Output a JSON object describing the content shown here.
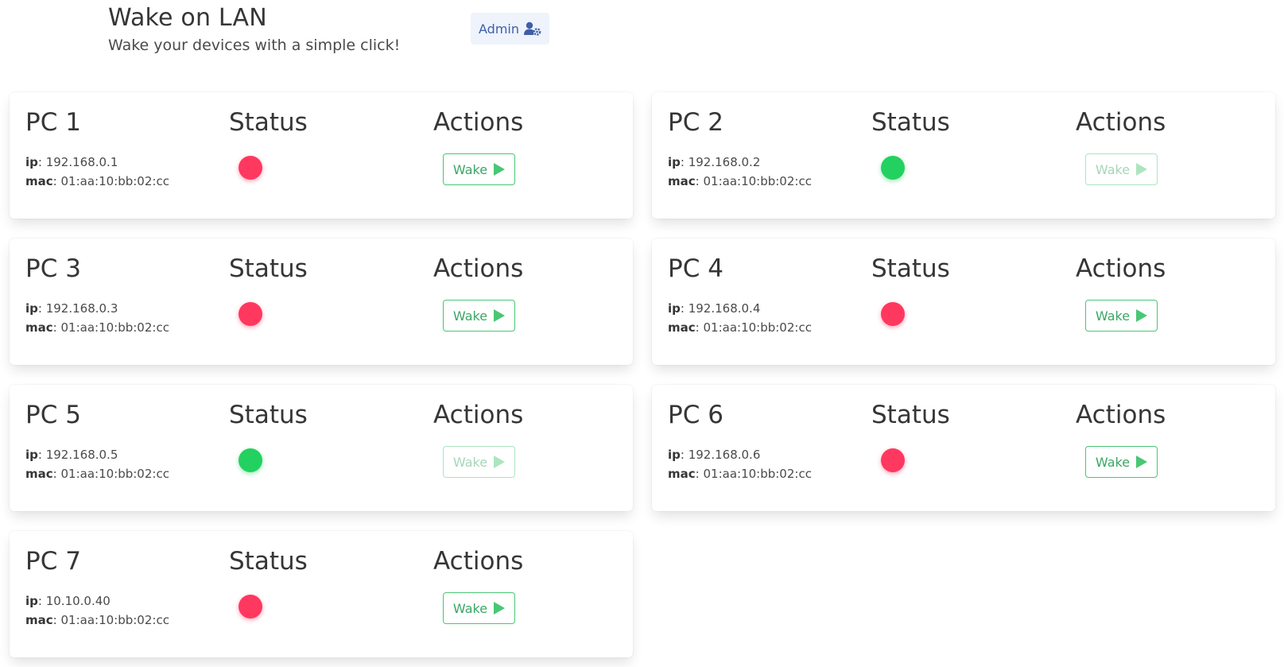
{
  "app": {
    "title": "Wake on LAN",
    "subtitle": "Wake your devices with a simple click!",
    "admin_label": "Admin"
  },
  "labels": {
    "status": "Status",
    "actions": "Actions",
    "ip_key": "ip",
    "mac_key": "mac",
    "wake": "Wake"
  },
  "colors": {
    "online": "#23d160",
    "offline": "#ff3860",
    "wake_accent": "#48c774",
    "admin_accent": "#3e5fa8"
  },
  "devices": [
    {
      "name": "PC 1",
      "ip": "192.168.0.1",
      "mac": "01:aa:10:bb:02:cc",
      "status": "offline"
    },
    {
      "name": "PC 2",
      "ip": "192.168.0.2",
      "mac": "01:aa:10:bb:02:cc",
      "status": "online"
    },
    {
      "name": "PC 3",
      "ip": "192.168.0.3",
      "mac": "01:aa:10:bb:02:cc",
      "status": "offline"
    },
    {
      "name": "PC 4",
      "ip": "192.168.0.4",
      "mac": "01:aa:10:bb:02:cc",
      "status": "offline"
    },
    {
      "name": "PC 5",
      "ip": "192.168.0.5",
      "mac": "01:aa:10:bb:02:cc",
      "status": "online"
    },
    {
      "name": "PC 6",
      "ip": "192.168.0.6",
      "mac": "01:aa:10:bb:02:cc",
      "status": "offline"
    },
    {
      "name": "PC 7",
      "ip": "10.10.0.40",
      "mac": "01:aa:10:bb:02:cc",
      "status": "offline"
    }
  ]
}
